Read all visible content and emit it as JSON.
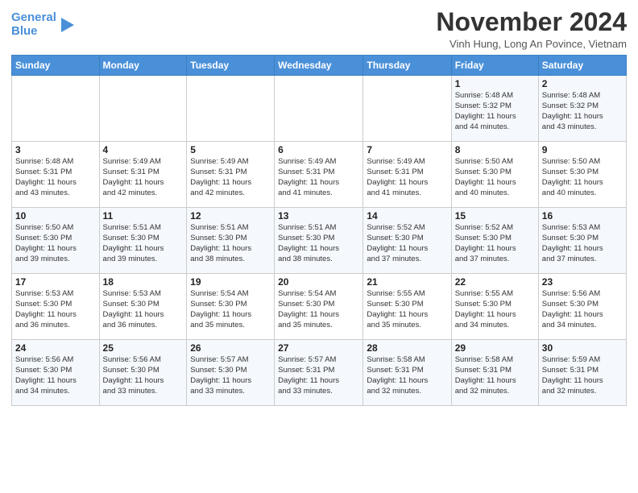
{
  "header": {
    "logo_line1": "General",
    "logo_line2": "Blue",
    "month": "November 2024",
    "location": "Vinh Hung, Long An Povince, Vietnam"
  },
  "weekdays": [
    "Sunday",
    "Monday",
    "Tuesday",
    "Wednesday",
    "Thursday",
    "Friday",
    "Saturday"
  ],
  "weeks": [
    [
      {
        "day": "",
        "info": ""
      },
      {
        "day": "",
        "info": ""
      },
      {
        "day": "",
        "info": ""
      },
      {
        "day": "",
        "info": ""
      },
      {
        "day": "",
        "info": ""
      },
      {
        "day": "1",
        "info": "Sunrise: 5:48 AM\nSunset: 5:32 PM\nDaylight: 11 hours\nand 44 minutes."
      },
      {
        "day": "2",
        "info": "Sunrise: 5:48 AM\nSunset: 5:32 PM\nDaylight: 11 hours\nand 43 minutes."
      }
    ],
    [
      {
        "day": "3",
        "info": "Sunrise: 5:48 AM\nSunset: 5:31 PM\nDaylight: 11 hours\nand 43 minutes."
      },
      {
        "day": "4",
        "info": "Sunrise: 5:49 AM\nSunset: 5:31 PM\nDaylight: 11 hours\nand 42 minutes."
      },
      {
        "day": "5",
        "info": "Sunrise: 5:49 AM\nSunset: 5:31 PM\nDaylight: 11 hours\nand 42 minutes."
      },
      {
        "day": "6",
        "info": "Sunrise: 5:49 AM\nSunset: 5:31 PM\nDaylight: 11 hours\nand 41 minutes."
      },
      {
        "day": "7",
        "info": "Sunrise: 5:49 AM\nSunset: 5:31 PM\nDaylight: 11 hours\nand 41 minutes."
      },
      {
        "day": "8",
        "info": "Sunrise: 5:50 AM\nSunset: 5:30 PM\nDaylight: 11 hours\nand 40 minutes."
      },
      {
        "day": "9",
        "info": "Sunrise: 5:50 AM\nSunset: 5:30 PM\nDaylight: 11 hours\nand 40 minutes."
      }
    ],
    [
      {
        "day": "10",
        "info": "Sunrise: 5:50 AM\nSunset: 5:30 PM\nDaylight: 11 hours\nand 39 minutes."
      },
      {
        "day": "11",
        "info": "Sunrise: 5:51 AM\nSunset: 5:30 PM\nDaylight: 11 hours\nand 39 minutes."
      },
      {
        "day": "12",
        "info": "Sunrise: 5:51 AM\nSunset: 5:30 PM\nDaylight: 11 hours\nand 38 minutes."
      },
      {
        "day": "13",
        "info": "Sunrise: 5:51 AM\nSunset: 5:30 PM\nDaylight: 11 hours\nand 38 minutes."
      },
      {
        "day": "14",
        "info": "Sunrise: 5:52 AM\nSunset: 5:30 PM\nDaylight: 11 hours\nand 37 minutes."
      },
      {
        "day": "15",
        "info": "Sunrise: 5:52 AM\nSunset: 5:30 PM\nDaylight: 11 hours\nand 37 minutes."
      },
      {
        "day": "16",
        "info": "Sunrise: 5:53 AM\nSunset: 5:30 PM\nDaylight: 11 hours\nand 37 minutes."
      }
    ],
    [
      {
        "day": "17",
        "info": "Sunrise: 5:53 AM\nSunset: 5:30 PM\nDaylight: 11 hours\nand 36 minutes."
      },
      {
        "day": "18",
        "info": "Sunrise: 5:53 AM\nSunset: 5:30 PM\nDaylight: 11 hours\nand 36 minutes."
      },
      {
        "day": "19",
        "info": "Sunrise: 5:54 AM\nSunset: 5:30 PM\nDaylight: 11 hours\nand 35 minutes."
      },
      {
        "day": "20",
        "info": "Sunrise: 5:54 AM\nSunset: 5:30 PM\nDaylight: 11 hours\nand 35 minutes."
      },
      {
        "day": "21",
        "info": "Sunrise: 5:55 AM\nSunset: 5:30 PM\nDaylight: 11 hours\nand 35 minutes."
      },
      {
        "day": "22",
        "info": "Sunrise: 5:55 AM\nSunset: 5:30 PM\nDaylight: 11 hours\nand 34 minutes."
      },
      {
        "day": "23",
        "info": "Sunrise: 5:56 AM\nSunset: 5:30 PM\nDaylight: 11 hours\nand 34 minutes."
      }
    ],
    [
      {
        "day": "24",
        "info": "Sunrise: 5:56 AM\nSunset: 5:30 PM\nDaylight: 11 hours\nand 34 minutes."
      },
      {
        "day": "25",
        "info": "Sunrise: 5:56 AM\nSunset: 5:30 PM\nDaylight: 11 hours\nand 33 minutes."
      },
      {
        "day": "26",
        "info": "Sunrise: 5:57 AM\nSunset: 5:30 PM\nDaylight: 11 hours\nand 33 minutes."
      },
      {
        "day": "27",
        "info": "Sunrise: 5:57 AM\nSunset: 5:31 PM\nDaylight: 11 hours\nand 33 minutes."
      },
      {
        "day": "28",
        "info": "Sunrise: 5:58 AM\nSunset: 5:31 PM\nDaylight: 11 hours\nand 32 minutes."
      },
      {
        "day": "29",
        "info": "Sunrise: 5:58 AM\nSunset: 5:31 PM\nDaylight: 11 hours\nand 32 minutes."
      },
      {
        "day": "30",
        "info": "Sunrise: 5:59 AM\nSunset: 5:31 PM\nDaylight: 11 hours\nand 32 minutes."
      }
    ]
  ]
}
